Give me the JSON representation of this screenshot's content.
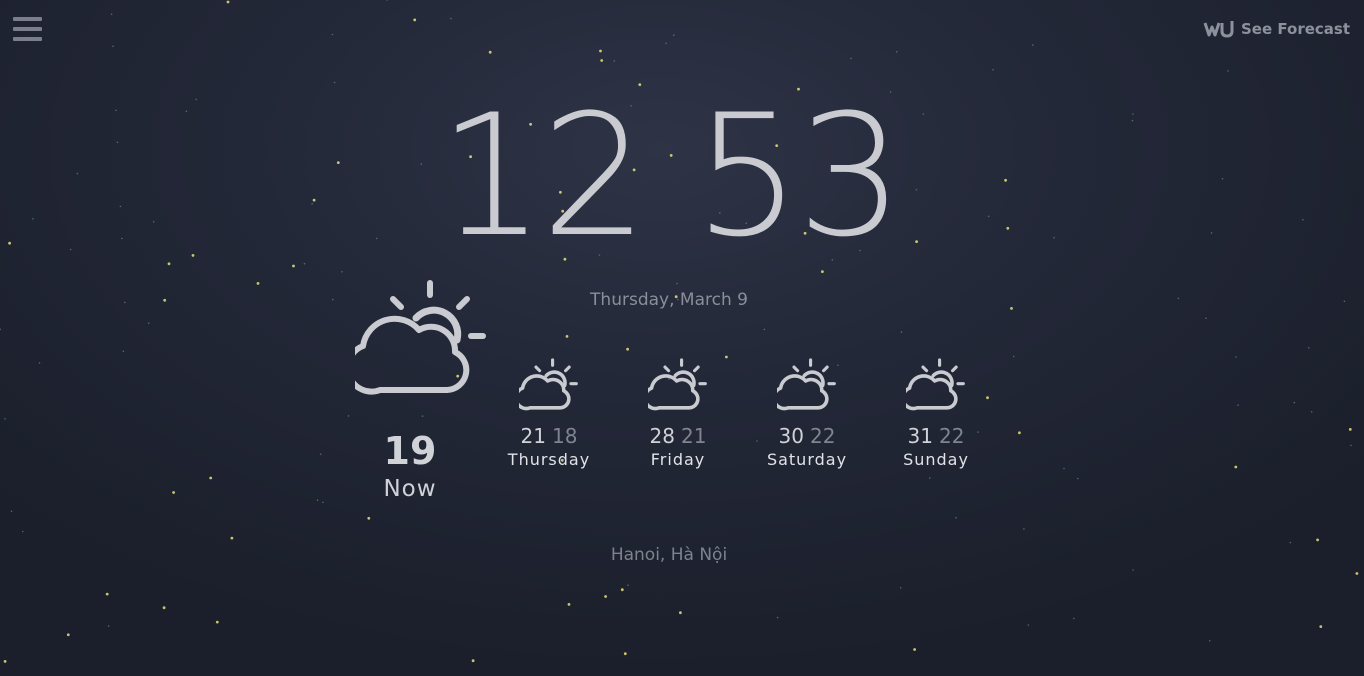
{
  "header": {
    "menu_icon": "hamburger-icon",
    "logo_text": "WU",
    "forecast_link": "See Forecast"
  },
  "clock": {
    "hours": "12",
    "minutes": "53"
  },
  "date": "Thursday, March 9",
  "current": {
    "icon": "partly-sunny-icon",
    "temperature": "19",
    "label": "Now"
  },
  "forecast": [
    {
      "icon": "partly-sunny-icon",
      "high": "21",
      "low": "18",
      "day": "Thursday"
    },
    {
      "icon": "partly-sunny-icon",
      "high": "28",
      "low": "21",
      "day": "Friday"
    },
    {
      "icon": "partly-sunny-icon",
      "high": "30",
      "low": "22",
      "day": "Saturday"
    },
    {
      "icon": "partly-sunny-icon",
      "high": "31",
      "low": "22",
      "day": "Sunday"
    }
  ],
  "location": "Hanoi, Hà Nội",
  "colors": {
    "background": "#232838",
    "text_primary": "#c9cbd1",
    "text_muted": "#80848f",
    "star": "#e8e37a"
  }
}
